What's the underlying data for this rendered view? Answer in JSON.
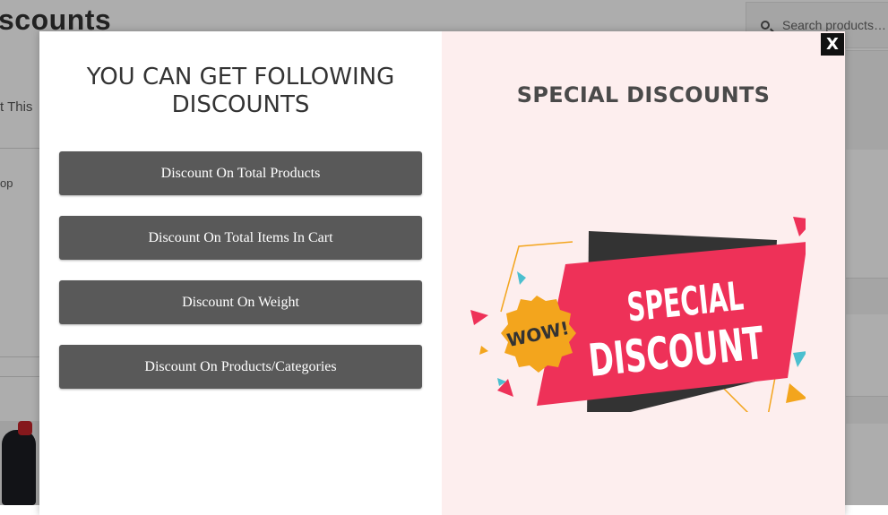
{
  "background": {
    "page_title": "scounts",
    "search_placeholder": "Search products…",
    "text_line1": "t This",
    "text_line2": "op"
  },
  "modal": {
    "heading_line1": "YOU CAN GET FOLLOWING",
    "heading_line2": "DISCOUNTS",
    "buttons": [
      {
        "label": "Discount On Total Products"
      },
      {
        "label": "Discount On Total Items In Cart"
      },
      {
        "label": "Discount On Weight"
      },
      {
        "label": "Discount On Products/Categories"
      }
    ],
    "right_title": "SPECIAL DISCOUNTS",
    "close_label": "X",
    "banner": {
      "badge_text": "WOW!",
      "line1": "SPECIAL",
      "line2": "DISCOUNT"
    }
  },
  "colors": {
    "button_bg": "#595959",
    "right_panel_bg": "#fdeeee",
    "banner_pink": "#ee3158",
    "banner_dark": "#333333",
    "badge_orange": "#f3a51d",
    "accent_teal": "#4bbfcf"
  }
}
